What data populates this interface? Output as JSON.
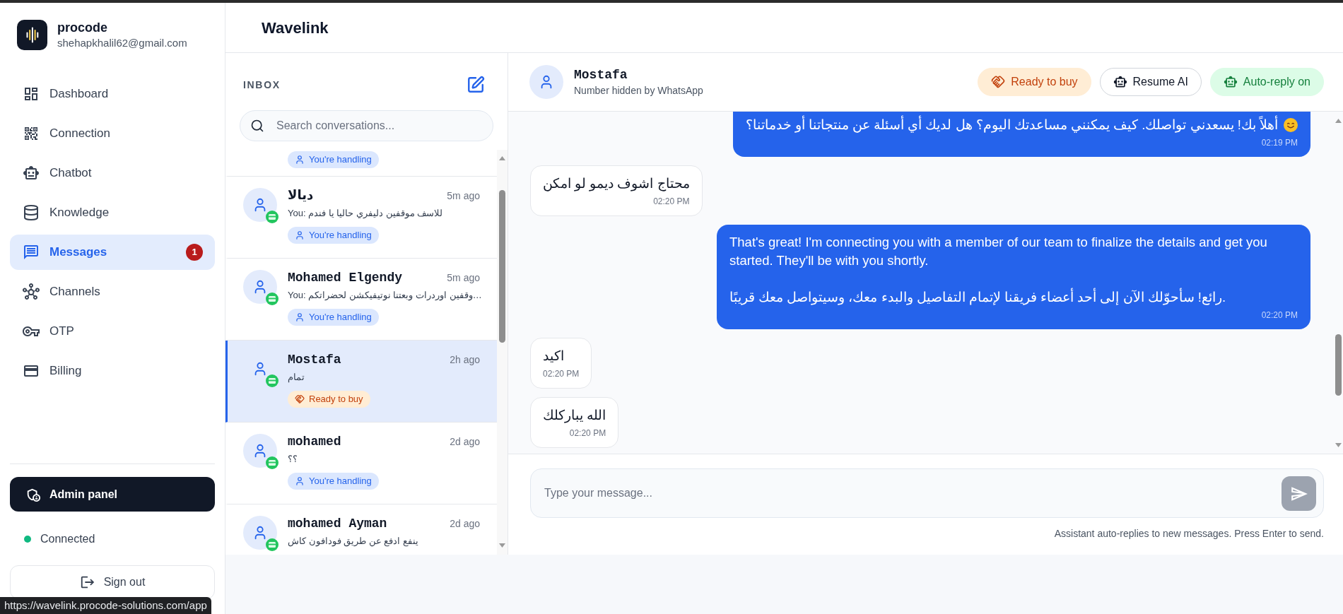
{
  "account": {
    "name": "procode",
    "email": "shehapkhalil62@gmail.com"
  },
  "nav": [
    {
      "label": "Dashboard",
      "selected": false
    },
    {
      "label": "Connection",
      "selected": false
    },
    {
      "label": "Chatbot",
      "selected": false
    },
    {
      "label": "Knowledge",
      "selected": false
    },
    {
      "label": "Messages",
      "selected": true,
      "badge": "1"
    },
    {
      "label": "Channels",
      "selected": false
    },
    {
      "label": "OTP",
      "selected": false
    },
    {
      "label": "Billing",
      "selected": false
    }
  ],
  "admin_button": {
    "label": "Admin panel"
  },
  "connection": {
    "label": "Connected",
    "connected": true
  },
  "sign_out": {
    "label": "Sign out"
  },
  "header": {
    "title": "Wavelink"
  },
  "inbox": {
    "title": "INBOX",
    "search": {
      "placeholder": "Search conversations..."
    },
    "conversations": [
      {
        "tag": {
          "kind": "handling",
          "label": "You're handling"
        },
        "selected": false
      },
      {
        "name": "ديالا",
        "time": "5m ago",
        "preview": "You: للاسف موقفين دليفري حاليا يا فندم",
        "tag": {
          "kind": "handling",
          "label": "You're handling"
        },
        "selected": false
      },
      {
        "name": "Mohamed Elgendy",
        "time": "5m ago",
        "preview": "You: وقفين اوردرات وبعتنا نوتيفيكشن لحضراتكم…",
        "tag": {
          "kind": "handling",
          "label": "You're handling"
        },
        "selected": false
      },
      {
        "name": "Mostafa",
        "time": "2h ago",
        "preview": "تمام",
        "tag": {
          "kind": "ready",
          "label": "Ready to buy"
        },
        "selected": true
      },
      {
        "name": "mohamed",
        "time": "2d ago",
        "preview": "؟؟",
        "tag": {
          "kind": "handling",
          "label": "You're handling"
        },
        "selected": false
      },
      {
        "name": "mohamed Ayman",
        "time": "2d ago",
        "preview": "ينفع ادفع عن طريق فودافون كاش",
        "selected": false
      }
    ]
  },
  "chat": {
    "contact": {
      "name": "Mostafa",
      "subtitle": "Number hidden by WhatsApp"
    },
    "actions": [
      {
        "kind": "ready",
        "label": "Ready to buy"
      },
      {
        "kind": "resume",
        "label": "Resume AI"
      },
      {
        "kind": "auto_reply",
        "label": "Auto-reply on"
      }
    ],
    "messages": [
      {
        "kind": "outgoing",
        "text": "أهلاً بك! يسعدني تواصلك. كيف يمكنني مساعدتك اليوم؟ هل لديك أي أسئلة عن منتجاتنا أو خدماتنا؟",
        "emoji_icon": true,
        "time": "02:19 PM"
      },
      {
        "kind": "incoming",
        "text": "محتاج اشوف ديمو لو امكن",
        "emoji_icon": false,
        "time": "02:20 PM"
      },
      {
        "kind": "outgoing",
        "text": "That's great! I'm connecting you with a member of our team to finalize the details and get you started. They'll be with you shortly.\n\nرائع! سأحوّلك الآن إلى أحد أعضاء فريقنا لإتمام التفاصيل والبدء معك، وسيتواصل معك قريبًا.",
        "emoji_icon": false,
        "time": "02:20 PM"
      },
      {
        "kind": "incoming",
        "text": "اكيد",
        "emoji_icon": false,
        "time": "02:20 PM"
      },
      {
        "kind": "incoming",
        "text": "الله يباركلك",
        "emoji_icon": false,
        "time": "02:20 PM"
      }
    ],
    "composer": {
      "placeholder": "Type your message...",
      "send_disabled": true,
      "hint": "Assistant auto-replies to new messages. Press Enter to send."
    }
  },
  "status_url": "https://wavelink.procode-solutions.com/app"
}
